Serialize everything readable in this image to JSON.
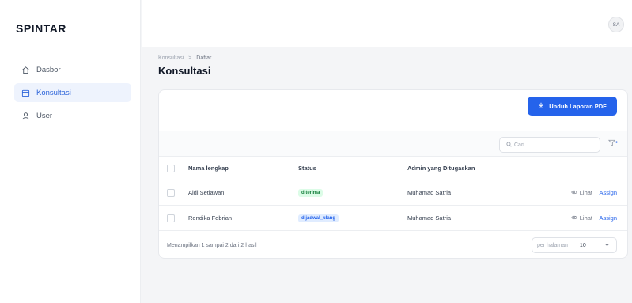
{
  "app": {
    "brand": "SPINTAR",
    "user_initials": "SA"
  },
  "sidebar": {
    "items": [
      {
        "label": "Dasbor",
        "icon": "home-icon",
        "active": false
      },
      {
        "label": "Konsultasi",
        "icon": "calendar-icon",
        "active": true
      },
      {
        "label": "User",
        "icon": "user-icon",
        "active": false
      }
    ]
  },
  "breadcrumb": {
    "parent": "Konsultasi",
    "separator": ">",
    "current": "Daftar"
  },
  "page": {
    "title": "Konsultasi"
  },
  "toolbar": {
    "export_label": "Unduh Laporan PDF"
  },
  "search": {
    "placeholder": "Cari"
  },
  "table": {
    "columns": [
      "Nama lengkap",
      "Status",
      "Admin yang Ditugaskan"
    ],
    "rows": [
      {
        "name": "Aldi Setiawan",
        "status": "diterima",
        "status_color": "#15803d",
        "admin": "Muhamad Satria",
        "view_label": "Lihat",
        "assign_label": "Assign"
      },
      {
        "name": "Rendika Febrian",
        "status": "dijadwal_ulang",
        "status_color": "#2563eb",
        "admin": "Muhamad Satria",
        "view_label": "Lihat",
        "assign_label": "Assign"
      }
    ]
  },
  "pagination": {
    "summary": "Menampilkan 1 sampai 2 dari 2 hasil",
    "per_page_label": "per halaman",
    "per_page_value": "10"
  },
  "colors": {
    "accent": "#2563eb",
    "active_bg": "#eef3fd"
  }
}
